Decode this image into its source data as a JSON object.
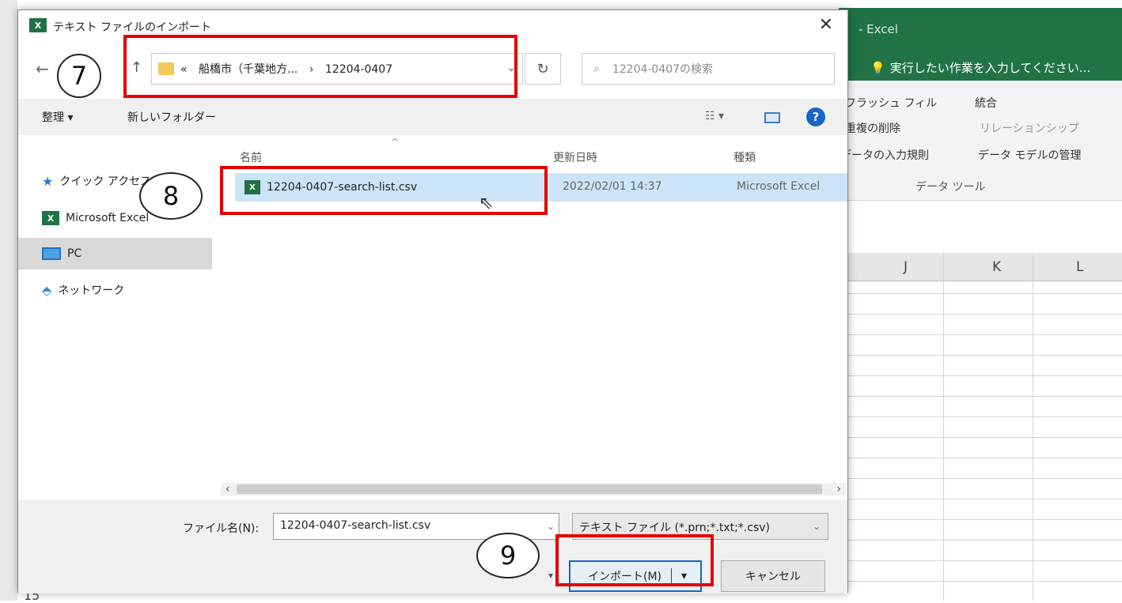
{
  "excel": {
    "title_suffix": "- Excel",
    "tell_me": "実行したい作業を入力してください...",
    "ribbon": {
      "flash_fill": "フラッシュ フィル",
      "remove_dup": "重複の削除",
      "data_validation": "データの入力規則",
      "consolidate": "統合",
      "relationships": "リレーションシップ",
      "data_model": "データ モデルの管理",
      "group": "データ ツール"
    },
    "columns": [
      "J",
      "K",
      "L"
    ],
    "row_number": "15"
  },
  "dialog": {
    "title": "テキスト ファイルのインポート",
    "close": "✕",
    "address": {
      "prefix": "«",
      "parent": "船橋市（千葉地方...",
      "sep": "›",
      "current": "12204-0407"
    },
    "search_placeholder": "12204-0407の検索",
    "toolbar": {
      "organize": "整理 ▾",
      "new_folder": "新しいフォルダー"
    },
    "nav": {
      "quick_access": "クイック アクセス",
      "microsoft_excel": "Microsoft Excel",
      "pc": "PC",
      "network": "ネットワーク"
    },
    "columns": {
      "name": "名前",
      "date": "更新日時",
      "type": "種類"
    },
    "files": [
      {
        "name": "12204-0407-search-list.csv",
        "date": "2022/02/01 14:37",
        "type": "Microsoft Excel"
      }
    ],
    "filename_label": "ファイル名(N):",
    "filename_value": "12204-0407-search-list.csv",
    "filetype": "テキスト ファイル (*.prn;*.txt;*.csv)",
    "import_button": "インポート(M)",
    "cancel_button": "キャンセル"
  },
  "annotations": {
    "step7": "7",
    "step8": "8",
    "step9": "9",
    "highlight_color": "#e30000"
  }
}
